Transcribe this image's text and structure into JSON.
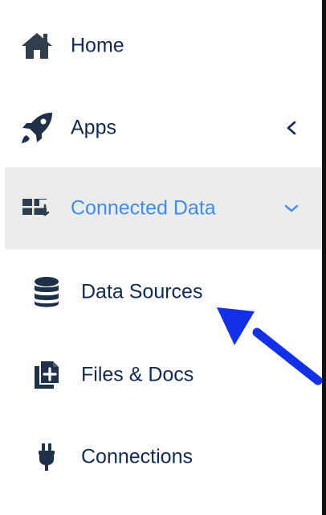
{
  "sidebar": {
    "items": [
      {
        "label": "Home",
        "icon": "home-icon"
      },
      {
        "label": "Apps",
        "icon": "rocket-icon",
        "expanded": false
      },
      {
        "label": "Connected Data",
        "icon": "connected-data-icon",
        "expanded": true,
        "active": true
      },
      {
        "label": "Data Sources",
        "icon": "database-icon"
      },
      {
        "label": "Files & Docs",
        "icon": "file-add-icon"
      },
      {
        "label": "Connections",
        "icon": "plug-icon"
      }
    ]
  },
  "colors": {
    "text": "#102a54",
    "active": "#3d8cf0",
    "expanded_background": "#ececec",
    "annotation": "#1230e8"
  }
}
